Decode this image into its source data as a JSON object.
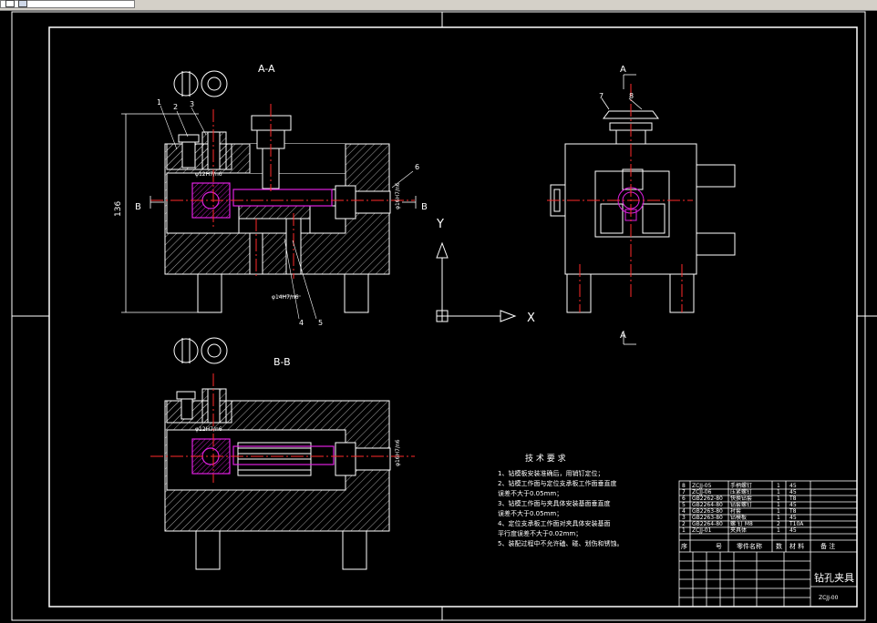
{
  "toolbar": {
    "field": ""
  },
  "views": {
    "section_aa": "A-A",
    "section_bb": "B-B"
  },
  "axis": {
    "y": "Y",
    "x": "X"
  },
  "labels": {
    "a_top": "A",
    "a_bottom": "A",
    "b_left": "B",
    "b_right": "B",
    "dim_height": "136",
    "callout_1": "1",
    "callout_2": "2",
    "callout_3": "3",
    "callout_4": "4",
    "callout_5": "5",
    "callout_6": "6",
    "callout_7": "7",
    "callout_8": "8",
    "fit_1": "φ12H7/n6",
    "fit_2": "φ14H7/n6",
    "fit_3": "φ12H7/n6",
    "fit_4": "φ14H7/n6",
    "fit_side_1": "φ16H7/n6",
    "fit_side_2": "φ16H7/n6"
  },
  "notes": {
    "title": "技 术 要 求",
    "lines": [
      "1、钻模板安装准确后，用销钉定位；",
      "2、钻模工作面与定位支承板工作面垂直度",
      "   误差不大于0.05mm；",
      "3、钻模工作面与夹具体安装基面垂直度",
      "   误差不大于0.05mm；",
      "4、定位支承板工作面对夹具体安装基面",
      "   平行度误差不大于0.02mm；",
      "5、装配过程中不允许磕、碰、划伤和锈蚀。"
    ]
  },
  "bom": {
    "rows": [
      [
        "8",
        "ZCJJ-05",
        "手柄螺钉",
        "1",
        "45"
      ],
      [
        "7",
        "ZCJJ-06",
        "压紧螺钉",
        "1",
        "45"
      ],
      [
        "6",
        "GB2262-80",
        "快换钻套",
        "1",
        "T8"
      ],
      [
        "5",
        "GB2264-80",
        "钻套螺钉",
        "1",
        "45"
      ],
      [
        "4",
        "GB2263-80",
        "衬套",
        "1",
        "T8"
      ],
      [
        "3",
        "GB2263-80",
        "钻模板",
        "1",
        "45"
      ],
      [
        "2",
        "GB2264-80",
        "螺 钉 M8",
        "2",
        "T10A"
      ],
      [
        "1",
        "ZCJJ-01",
        "夹具体",
        "1",
        "45"
      ]
    ],
    "header": [
      "序",
      "号",
      "零件名称",
      "数",
      "材 料",
      "备 注"
    ]
  },
  "title_block": {
    "name": "钻孔夹具",
    "code": "ZCJJ-00"
  },
  "colors": {
    "line": "#ffffff",
    "center": "#ff2a2a",
    "magenta": "#e020e0",
    "hatch": "#cfcfcf",
    "background": "#000000"
  }
}
